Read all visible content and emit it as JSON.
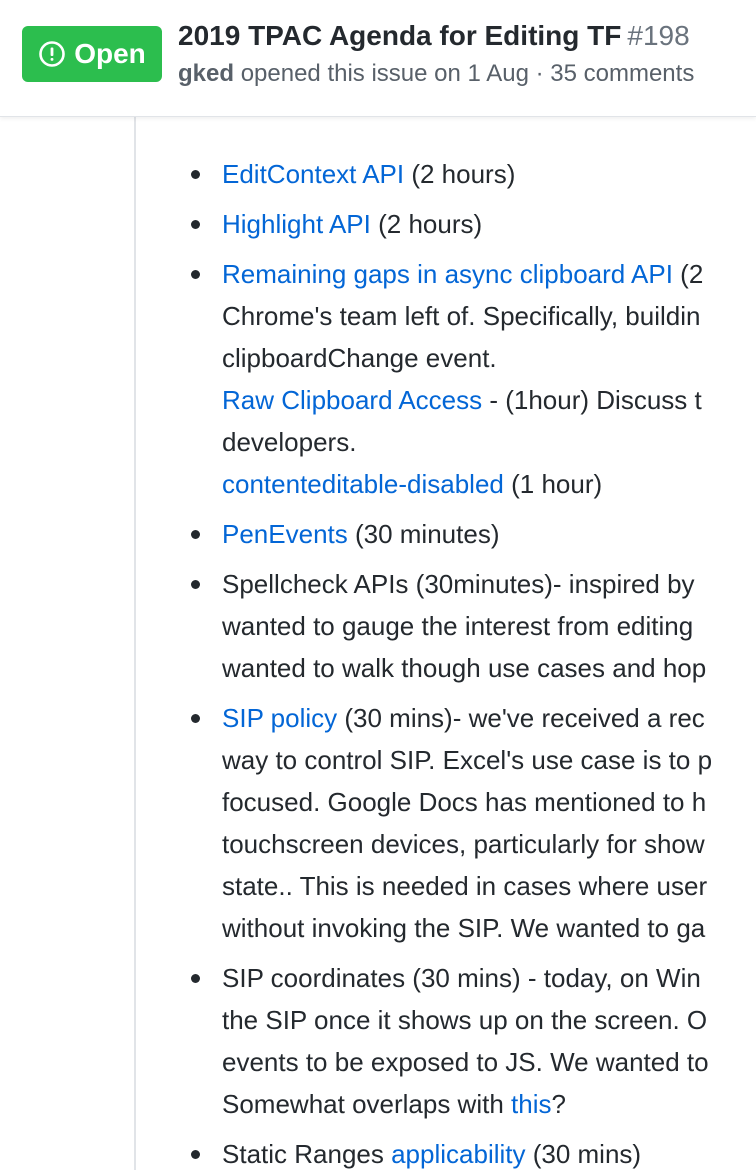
{
  "issue": {
    "state_label": "Open",
    "title": "2019 TPAC Agenda for Editing TF",
    "number": "#198",
    "author": "gked",
    "opened_text": "opened this issue on 1 Aug",
    "separator": "·",
    "comments": "35 comments"
  },
  "agenda": {
    "item1": {
      "link": "EditContext API",
      "rest": " (2 hours)"
    },
    "item2": {
      "link": "Highlight API",
      "rest": " (2 hours)"
    },
    "item3": {
      "link": "Remaining gaps in async clipboard API",
      "rest": " (2",
      "line2": "Chrome's team left of. Specifically, buildin",
      "line3": "clipboardChange event.",
      "sub1_link": "Raw Clipboard Access",
      "sub1_rest": " - (1hour) Discuss t",
      "line5": "developers.",
      "sub2_link": "contenteditable-disabled",
      "sub2_rest": " (1 hour)"
    },
    "item4": {
      "link": "PenEvents",
      "rest": " (30 minutes)"
    },
    "item5": {
      "line1": "Spellcheck APIs (30minutes)- inspired by",
      "line2": "wanted to gauge the interest from editing",
      "line3": "wanted to walk though use cases and hop"
    },
    "item6": {
      "link": "SIP policy",
      "rest": " (30 mins)- we've received a rec",
      "line2": "way to control SIP. Excel's use case is to p",
      "line3": "focused. Google Docs has mentioned to h",
      "line4": "touchscreen devices, particularly for show",
      "line5": "state.. This is needed in cases where user",
      "line6": "without invoking the SIP. We wanted to ga"
    },
    "item7": {
      "line1": "SIP coordinates (30 mins) - today, on Win",
      "line2": "the SIP once it shows up on the screen. O",
      "line3": "events to be exposed to JS. We wanted to",
      "line4_pre": "Somewhat overlaps with ",
      "line4_link": "this",
      "line4_post": "?"
    },
    "item8": {
      "pre": "Static Ranges ",
      "link": "applicability",
      "rest": " (30 mins)"
    }
  },
  "colors": {
    "open_green": "#2cbe4e",
    "link_blue": "#0366d6",
    "text": "#24292e",
    "muted": "#586069"
  },
  "icons": {
    "state": "issue-opened-icon"
  }
}
